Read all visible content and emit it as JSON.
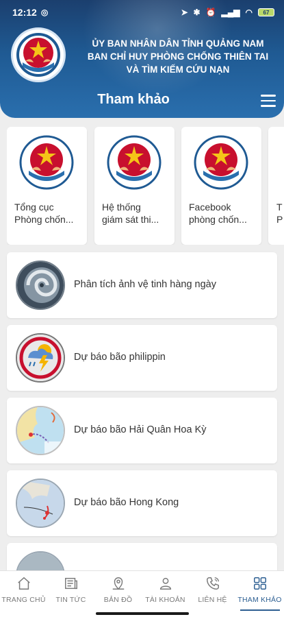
{
  "status_bar": {
    "time": "12:12",
    "battery": "67"
  },
  "header": {
    "org_line1": "ỦY BAN NHÂN DÂN TỈNH QUẢNG NAM",
    "org_line2": "BAN CHỈ HUY PHÒNG CHỐNG THIÊN TAI",
    "org_line3": "VÀ TÌM KIẾM CỨU NẠN",
    "page_title": "Tham khảo"
  },
  "cards": [
    {
      "title": "Tổng cục\nPhòng chốn..."
    },
    {
      "title": "Hệ thống\ngiám sát thi..."
    },
    {
      "title": "Facebook\nphòng chốn..."
    },
    {
      "title": "T\nP"
    }
  ],
  "list": [
    {
      "label": "Phân tích ảnh vệ tinh hàng ngày",
      "icon": "satellite-image-icon"
    },
    {
      "label": "Dự báo bão philippin",
      "icon": "weather-warning-icon"
    },
    {
      "label": "Dự báo bão Hải Quân Hoa Kỳ",
      "icon": "storm-map-icon"
    },
    {
      "label": "Dự báo bão Hong Kong",
      "icon": "typhoon-track-map-icon"
    }
  ],
  "bottom_nav": [
    {
      "label": "TRANG CHỦ",
      "icon": "home-icon"
    },
    {
      "label": "TIN TỨC",
      "icon": "news-icon"
    },
    {
      "label": "BẢN ĐỒ",
      "icon": "map-pin-icon"
    },
    {
      "label": "TÀI KHOẢN",
      "icon": "user-icon"
    },
    {
      "label": "LIÊN HỆ",
      "icon": "phone-icon"
    },
    {
      "label": "THAM KHẢO",
      "icon": "grid-icon"
    }
  ],
  "colors": {
    "header_blue": "#1f5a93",
    "active_nav": "#2d5f92",
    "emblem_red": "#c8102e",
    "emblem_gold": "#f5c518"
  }
}
